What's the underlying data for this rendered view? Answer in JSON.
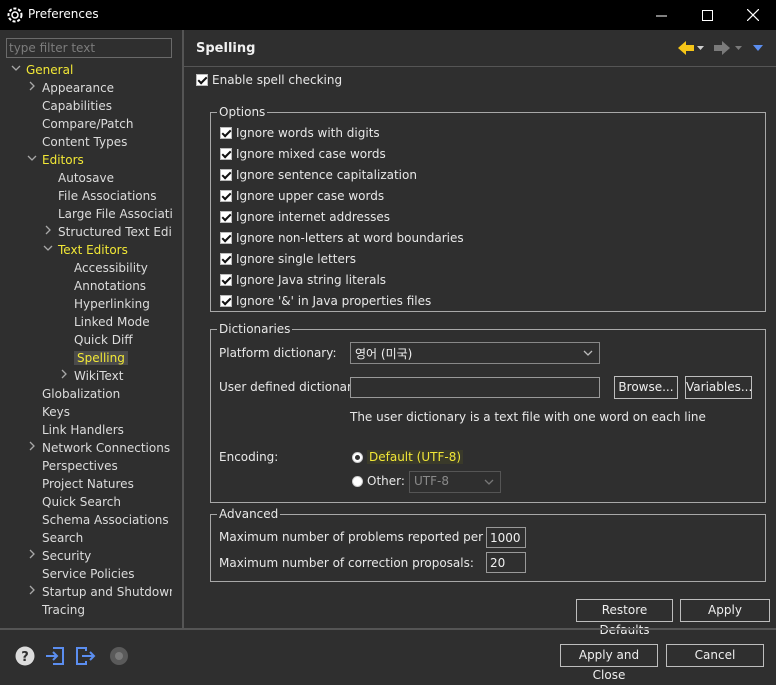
{
  "window": {
    "title": "Preferences",
    "controls": {
      "minimize": "—",
      "maximize": "☐",
      "close": "✕"
    }
  },
  "filter": {
    "placeholder": "type filter text",
    "value": ""
  },
  "tree": [
    {
      "label": "General",
      "level": 0,
      "twisty": "open",
      "yellow": true
    },
    {
      "label": "Appearance",
      "level": 1,
      "twisty": "closed"
    },
    {
      "label": "Capabilities",
      "level": 1,
      "twisty": "none"
    },
    {
      "label": "Compare/Patch",
      "level": 1,
      "twisty": "none"
    },
    {
      "label": "Content Types",
      "level": 1,
      "twisty": "none"
    },
    {
      "label": "Editors",
      "level": 1,
      "twisty": "open",
      "yellow": true
    },
    {
      "label": "Autosave",
      "level": 2,
      "twisty": "none"
    },
    {
      "label": "File Associations",
      "level": 2,
      "twisty": "none"
    },
    {
      "label": "Large File Associatic",
      "level": 2,
      "twisty": "none"
    },
    {
      "label": "Structured Text Edit",
      "level": 2,
      "twisty": "closed"
    },
    {
      "label": "Text Editors",
      "level": 2,
      "twisty": "open",
      "yellow": true
    },
    {
      "label": "Accessibility",
      "level": 3,
      "twisty": "none"
    },
    {
      "label": "Annotations",
      "level": 3,
      "twisty": "none"
    },
    {
      "label": "Hyperlinking",
      "level": 3,
      "twisty": "none"
    },
    {
      "label": "Linked Mode",
      "level": 3,
      "twisty": "none"
    },
    {
      "label": "Quick Diff",
      "level": 3,
      "twisty": "none"
    },
    {
      "label": "Spelling",
      "level": 3,
      "twisty": "none",
      "yellow": true,
      "selected": true
    },
    {
      "label": "WikiText",
      "level": 3,
      "twisty": "closed"
    },
    {
      "label": "Globalization",
      "level": 1,
      "twisty": "none"
    },
    {
      "label": "Keys",
      "level": 1,
      "twisty": "none"
    },
    {
      "label": "Link Handlers",
      "level": 1,
      "twisty": "none"
    },
    {
      "label": "Network Connections",
      "level": 1,
      "twisty": "closed"
    },
    {
      "label": "Perspectives",
      "level": 1,
      "twisty": "none"
    },
    {
      "label": "Project Natures",
      "level": 1,
      "twisty": "none"
    },
    {
      "label": "Quick Search",
      "level": 1,
      "twisty": "none"
    },
    {
      "label": "Schema Associations",
      "level": 1,
      "twisty": "none"
    },
    {
      "label": "Search",
      "level": 1,
      "twisty": "none"
    },
    {
      "label": "Security",
      "level": 1,
      "twisty": "closed"
    },
    {
      "label": "Service Policies",
      "level": 1,
      "twisty": "none"
    },
    {
      "label": "Startup and Shutdown",
      "level": 1,
      "twisty": "closed"
    },
    {
      "label": "Tracing",
      "level": 1,
      "twisty": "none"
    }
  ],
  "page": {
    "title": "Spelling",
    "enable_spell": "Enable spell checking",
    "options_title": "Options",
    "options": [
      "Ignore words with digits",
      "Ignore mixed case words",
      "Ignore sentence capitalization",
      "Ignore upper case words",
      "Ignore internet addresses",
      "Ignore non-letters at word boundaries",
      "Ignore single letters",
      "Ignore Java string literals",
      "Ignore '&' in Java properties files"
    ],
    "dictionaries_title": "Dictionaries",
    "platform_dict_label": "Platform dictionary:",
    "platform_dict_value": "영어 (미국)",
    "user_dict_label": "User defined dictionary:",
    "user_dict_value": "",
    "browse": "Browse...",
    "variables": "Variables...",
    "user_dict_hint": "The user dictionary is a text file with one word on each line",
    "encoding_label": "Encoding:",
    "encoding_default": "Default (UTF-8)",
    "encoding_other": "Other:",
    "encoding_other_value": "UTF-8",
    "advanced_title": "Advanced",
    "max_problems_label": "Maximum number of problems reported per file:",
    "max_problems_value": "1000",
    "max_proposals_label": "Maximum number of correction proposals:",
    "max_proposals_value": "20",
    "restore_defaults": "Restore Defaults",
    "apply": "Apply"
  },
  "footer": {
    "apply_close": "Apply and Close",
    "cancel": "Cancel"
  },
  "colors": {
    "accent_yellow": "#f2e836",
    "nav_arrow": "#f5c518",
    "blue_icon": "#5b8ef0"
  }
}
